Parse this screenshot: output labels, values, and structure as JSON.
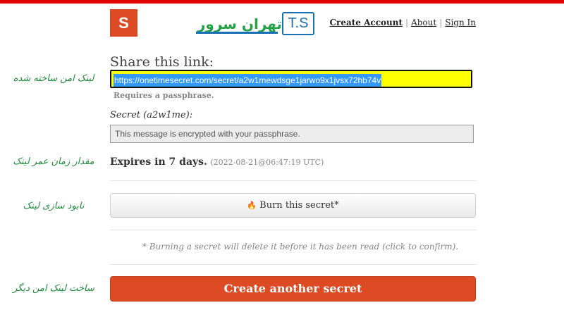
{
  "header": {
    "logo_letter": "S",
    "brand_fa": "تهران سرور",
    "brand_ts": "T.S",
    "nav": {
      "create_account": "Create Account",
      "about": "About",
      "sign_in": "Sign In",
      "separator": "|"
    }
  },
  "share": {
    "title": "Share this link:",
    "link": "https://onetimesecret.com/secret/a2w1mewdsge1jarwo9x1jvsx72hb74v",
    "requires": "Requires a passphrase."
  },
  "secret": {
    "label": "Secret (a2w1me):",
    "message": "This message is encrypted with your passphrase."
  },
  "expires": {
    "text": "Expires in 7 days.",
    "timestamp": "(2022-08-21@06:47:19 UTC)"
  },
  "burn": {
    "icon": "fire-icon",
    "icon_glyph": "🔥",
    "label": "Burn this secret*",
    "note": "* Burning a secret will delete it before it has been read (click to confirm)."
  },
  "create": {
    "label": "Create another secret"
  },
  "annotations": {
    "link": "لینک امن ساخته شده",
    "expiry": "مقدار زمان عمر لینک",
    "burn": "نابود سازی لینک",
    "create": "ساخت لینک امن دیگر"
  },
  "colors": {
    "accent": "#dd4b25",
    "highlight": "#ffff00",
    "selection": "#3399ff",
    "annotation": "#1f8a3a",
    "brand_blue": "#1a6fb5"
  }
}
